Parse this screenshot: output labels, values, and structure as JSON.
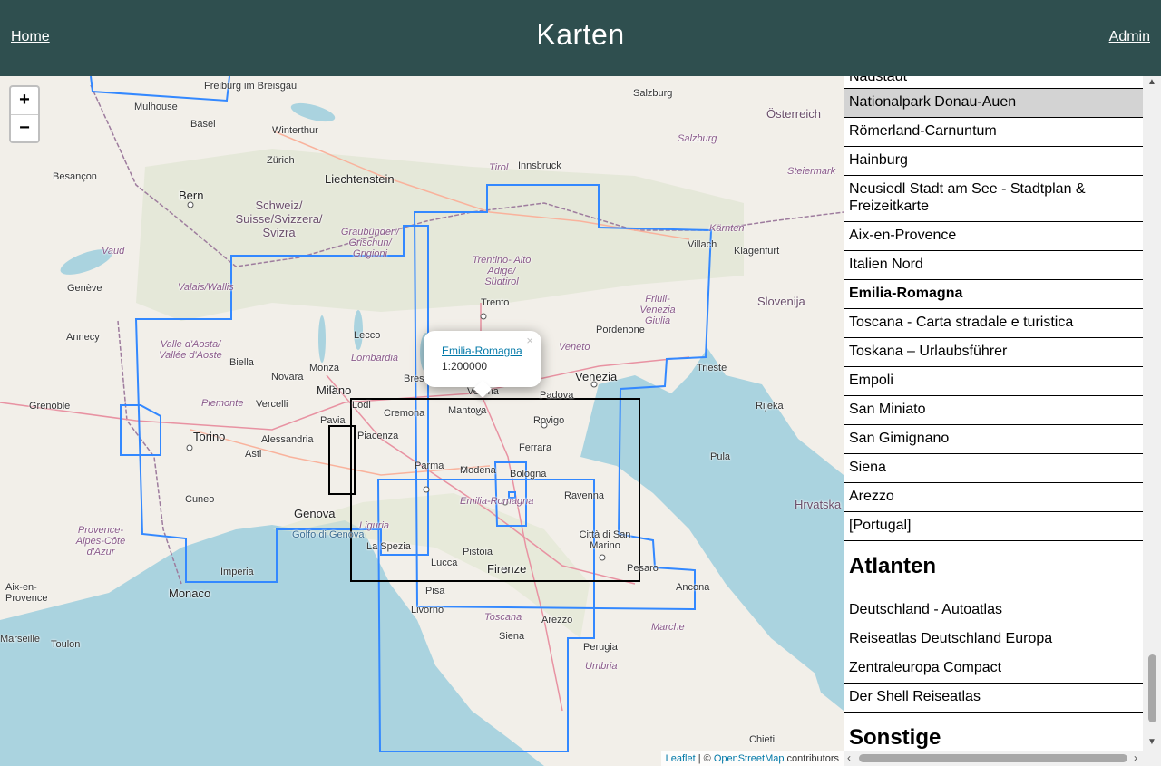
{
  "header": {
    "home_label": "Home",
    "title": "Karten",
    "admin_label": "Admin"
  },
  "map": {
    "zoom_in": "+",
    "zoom_out": "−",
    "popup": {
      "link": "Emilia-Romagna",
      "scale": "1:200000",
      "close": "×"
    },
    "attribution": {
      "leaflet": "Leaflet",
      "sep": " | © ",
      "osm": "OpenStreetMap",
      "suffix": " contributors"
    },
    "labels": {
      "freiburg": "Freiburg im Breisgau",
      "mulhouse": "Mulhouse",
      "basel": "Basel",
      "winterthur": "Winterthur",
      "zurich": "Zürich",
      "liechtenstein": "Liechtenstein",
      "salzburg": "Salzburg",
      "salzburg_region": "Salzburg",
      "oesterreich": "Österreich",
      "innsbruck": "Innsbruck",
      "tirol": "Tirol",
      "steiermark": "Steiermark",
      "besancon": "Besançon",
      "bern": "Bern",
      "schweiz": "Schweiz/ Suisse/Svizzera/ Svizra",
      "graubunden": "Graubünden/ Grischun/ Grigioni",
      "karnten": "Kärnten",
      "villach": "Villach",
      "klagenfurt": "Klagenfurt",
      "vaud": "Vaud",
      "geneve": "Genève",
      "valais": "Valais/Wallis",
      "trentino": "Trentino- Alto Adige/ Südtirol",
      "slovenija": "Slovenija",
      "friuli": "Friuli- Venezia Giulia",
      "annecy": "Annecy",
      "aosta": "Valle d'Aosta/ Vallée d'Aoste",
      "trento": "Trento",
      "lecco": "Lecco",
      "pordenone": "Pordenone",
      "trieste": "Trieste",
      "biella": "Biella",
      "novara": "Novara",
      "monza": "Monza",
      "bergamo": "Bergamo",
      "lombardia": "Lombardia",
      "veneto": "Veneto",
      "venezia": "Venezia",
      "grenoble": "Grenoble",
      "piemonte": "Piemonte",
      "vercelli": "Vercelli",
      "milano": "Milano",
      "brescia": "Brescia",
      "verona": "Verona",
      "padova": "Padova",
      "rijeka": "Rijeka",
      "lodi": "Lodi",
      "cremona": "Cremona",
      "mantova": "Mantova",
      "rovigo": "Rovigo",
      "pavia": "Pavia",
      "torino": "Torino",
      "alessandria": "Alessandria",
      "piacenza": "Piacenza",
      "ferrara": "Ferrara",
      "asti": "Asti",
      "parma": "Parma",
      "modena": "Modena",
      "bologna": "Bologna",
      "pula": "Pula",
      "emilia": "Emilia-Romagna",
      "ravenna": "Ravenna",
      "cuneo": "Cuneo",
      "hrvatska": "Hrvatska",
      "genova": "Genova",
      "liguria": "Liguria",
      "golfo": "Golfo di Genova",
      "provence": "Provence- Alpes-Côte d'Azur",
      "citta": "Città di San Marino",
      "laspezia": "La Spezia",
      "pistoia": "Pistoia",
      "imperia": "Imperia",
      "pesaro": "Pesaro",
      "ancona": "Ancona",
      "lucca": "Lucca",
      "firenze": "Firenze",
      "aix": "Aix-en- Provence",
      "monaco": "Monaco",
      "pisa": "Pisa",
      "livorno": "Livorno",
      "toscana": "Toscana",
      "arezzo": "Arezzo",
      "marche": "Marche",
      "marseille": "Marseille",
      "toulon": "Toulon",
      "siena": "Siena",
      "perugia": "Perugia",
      "umbria": "Umbria",
      "chieti": "Chieti"
    }
  },
  "sidebar": {
    "cut_item": "Nadstadt",
    "items": [
      {
        "label": "Nationalpark Donau-Auen",
        "selected": true
      },
      {
        "label": "Römerland-Carnuntum"
      },
      {
        "label": "Hainburg"
      },
      {
        "label": "Neusiedl Stadt am See - Stadtplan & Freizeitkarte"
      },
      {
        "label": "Aix-en-Provence"
      },
      {
        "label": "Italien Nord"
      },
      {
        "label": "Emilia-Romagna",
        "bold": true
      },
      {
        "label": "Toscana - Carta stradale e turistica"
      },
      {
        "label": "Toskana – Urlaubsführer"
      },
      {
        "label": "Empoli"
      },
      {
        "label": "San Miniato"
      },
      {
        "label": "San Gimignano"
      },
      {
        "label": "Siena"
      },
      {
        "label": "Arezzo"
      },
      {
        "label": "[Portugal]"
      }
    ],
    "atlanten_heading": "Atlanten",
    "atlanten": [
      {
        "label": "Deutschland - Autoatlas"
      },
      {
        "label": "Reiseatlas Deutschland Europa"
      },
      {
        "label": "Zentraleuropa Compact"
      },
      {
        "label": "Der Shell Reiseatlas"
      }
    ],
    "sonstige_heading": "Sonstige"
  }
}
